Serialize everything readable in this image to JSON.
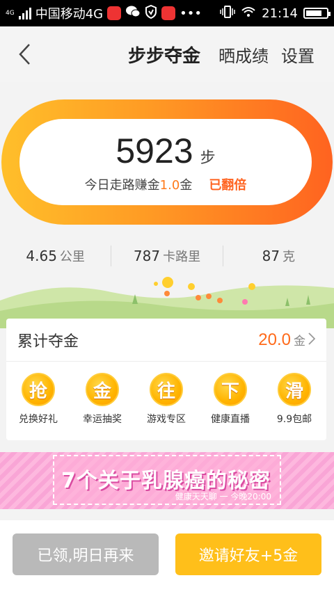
{
  "status_bar": {
    "network_badge": "4G",
    "carrier": "中国移动4G",
    "time": "21:14",
    "battery_level": 0.8
  },
  "nav": {
    "title": "步步夺金",
    "share_label": "晒成绩",
    "settings_label": "设置"
  },
  "steps": {
    "count": "5923",
    "unit": "步",
    "earn_prefix": "今日走路赚金",
    "earn_rate": "1.0",
    "earn_suffix": "金",
    "doubled_label": "已翻倍"
  },
  "stats": [
    {
      "value": "4.65",
      "unit": "公里"
    },
    {
      "value": "787",
      "unit": "卡路里"
    },
    {
      "value": "87",
      "unit": "克"
    }
  ],
  "gold": {
    "label": "累计夺金",
    "amount": "20.0",
    "unit": "金"
  },
  "features": [
    {
      "icon_char": "抢",
      "label": "兑换好礼"
    },
    {
      "icon_char": "金",
      "label": "幸运抽奖"
    },
    {
      "icon_char": "往",
      "label": "游戏专区"
    },
    {
      "icon_char": "下",
      "label": "健康直播"
    },
    {
      "icon_char": "滑",
      "label": "9.9包邮"
    }
  ],
  "banner": {
    "title": "7个关于乳腺癌的秘密",
    "subtitle": "健康天天聊 一 今晚20:00"
  },
  "buttons": {
    "claimed_label": "已领,明日再来",
    "invite_label": "邀请好友+5金"
  },
  "colors": {
    "accent_orange": "#ff6320",
    "accent_yellow": "#ffbf1a",
    "disabled_gray": "#b9b9b9"
  }
}
